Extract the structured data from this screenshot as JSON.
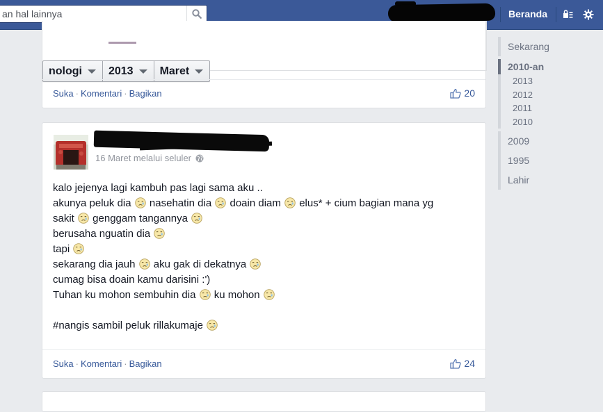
{
  "topbar": {
    "search_placeholder": "an hal lainnya",
    "home_label": "Beranda",
    "icons": [
      "search-icon",
      "privacy-lock-icon",
      "settings-gear-icon"
    ],
    "color": "#3b5998"
  },
  "filters": [
    {
      "label": "nologi"
    },
    {
      "label": "2013"
    },
    {
      "label": "Maret"
    }
  ],
  "post1": {
    "actions": {
      "like": "Suka",
      "sep": "·",
      "comment": "Komentari",
      "share": "Bagikan"
    },
    "like_count": "20"
  },
  "post2": {
    "date": "16 Maret melalui seluler",
    "lines": [
      {
        "text": "kalo jejenya lagi kambuh pas lagi sama aku .."
      },
      {
        "parts": [
          "akunya peluk dia ",
          "emoji",
          " nasehatin dia ",
          "emoji",
          " doain diam ",
          "emoji",
          " elus* + cium bagian mana yg"
        ]
      },
      {
        "parts": [
          "sakit ",
          "emoji",
          " genggam tangannya ",
          "emoji"
        ]
      },
      {
        "parts": [
          "berusaha nguatin dia ",
          "emoji"
        ]
      },
      {
        "parts": [
          "tapi ",
          "emoji"
        ]
      },
      {
        "parts": [
          "sekarang dia jauh ",
          "emoji",
          " aku gak di dekatnya ",
          "emoji"
        ]
      },
      {
        "text": "cumag bisa doain kamu darisini :')"
      },
      {
        "parts": [
          "Tuhan ku mohon sembuhin dia ",
          "emoji",
          " ku mohon ",
          "emoji"
        ]
      },
      {
        "text": ""
      },
      {
        "parts": [
          "#nangis sambil peluk rillakumaje ",
          "emoji"
        ]
      }
    ],
    "actions": {
      "like": "Suka",
      "sep": "·",
      "comment": "Komentari",
      "share": "Bagikan"
    },
    "like_count": "24"
  },
  "timeline": {
    "items": [
      {
        "label": "Sekarang"
      },
      {
        "label": "2010-an",
        "active": true,
        "sub": [
          "2013",
          "2012",
          "2011",
          "2010"
        ]
      },
      {
        "label": "2009"
      },
      {
        "label": "1995"
      },
      {
        "label": "Lahir"
      }
    ]
  }
}
